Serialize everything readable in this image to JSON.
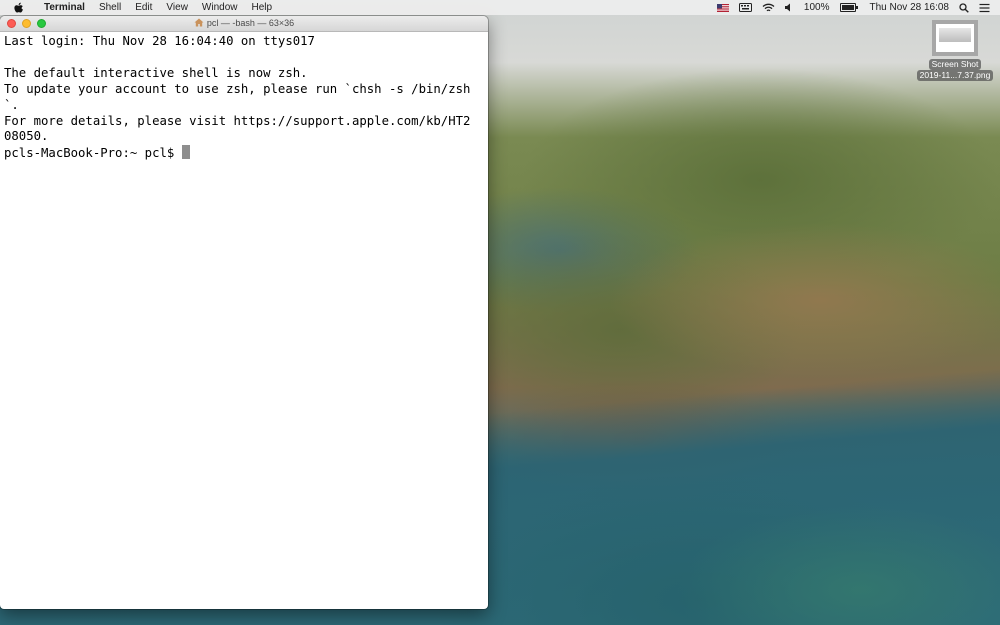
{
  "menubar": {
    "app_name": "Terminal",
    "items": [
      "Shell",
      "Edit",
      "View",
      "Window",
      "Help"
    ],
    "status": {
      "battery": "100%",
      "datetime": "Thu Nov 28  16:08"
    },
    "icons": [
      "apple-icon",
      "flag-icon",
      "keyboard-icon",
      "wifi-icon",
      "volume-icon",
      "battery-icon",
      "search-icon",
      "control-center-icon"
    ]
  },
  "window": {
    "title": "pcl — -bash — 63×36",
    "lines": [
      "Last login: Thu Nov 28 16:04:40 on ttys017",
      "",
      "The default interactive shell is now zsh.",
      "To update your account to use zsh, please run `chsh -s /bin/zsh",
      "`.",
      "For more details, please visit https://support.apple.com/kb/HT2",
      "08050."
    ],
    "prompt": "pcls-MacBook-Pro:~ pcl$ "
  },
  "desktop_icon": {
    "label_line1": "Screen Shot",
    "label_line2": "2019-11...7.37.png"
  },
  "colors": {
    "close": "#fd5c55",
    "minimize": "#fdbc2e",
    "maximize": "#28c840"
  }
}
